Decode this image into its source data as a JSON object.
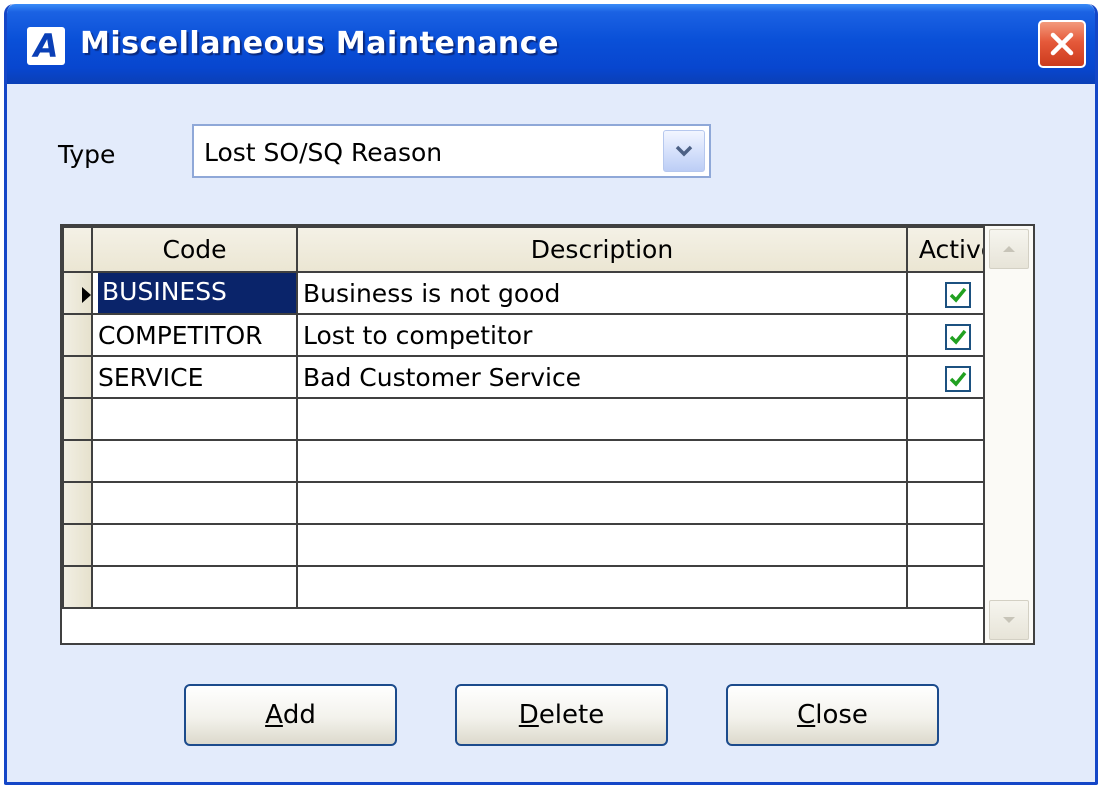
{
  "window": {
    "title": "Miscellaneous Maintenance",
    "app_icon_letter": "A",
    "close_icon": "close-icon"
  },
  "type_field": {
    "label": "Type",
    "value": "Lost SO/SQ Reason"
  },
  "grid": {
    "columns": [
      "Code",
      "Description",
      "Active"
    ],
    "rows": [
      {
        "code": "BUSINESS",
        "description": "Business is not good",
        "active": true,
        "selected": true
      },
      {
        "code": "COMPETITOR",
        "description": "Lost to competitor",
        "active": true,
        "selected": false
      },
      {
        "code": "SERVICE",
        "description": "Bad Customer Service",
        "active": true,
        "selected": false
      }
    ],
    "empty_rows": 5
  },
  "buttons": {
    "add": {
      "accel": "A",
      "rest": "dd"
    },
    "delete": {
      "accel": "D",
      "rest": "elete"
    },
    "close": {
      "accel": "C",
      "rest": "lose"
    }
  },
  "colors": {
    "title_bar": "#0846cf",
    "client_bg": "#e3ebfb",
    "close_button": "#e5593a",
    "selection": "#0a246a",
    "check": "#21a121"
  }
}
